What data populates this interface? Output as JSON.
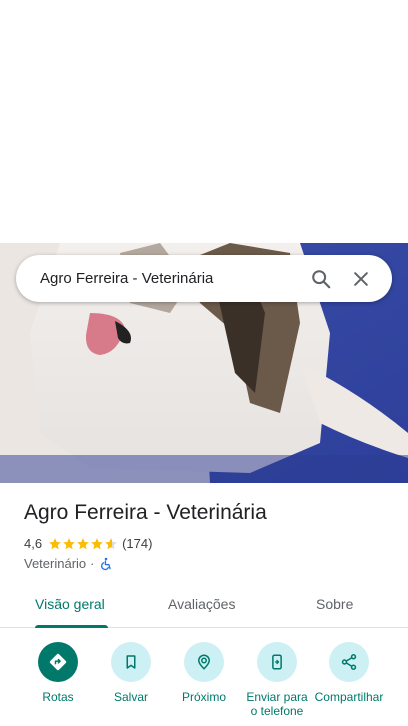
{
  "search": {
    "query": "Agro Ferreira - Veterinária"
  },
  "place": {
    "name": "Agro Ferreira - Veterinária",
    "rating": "4,6",
    "stars": 4.6,
    "review_count": "(174)",
    "category": "Veterinário",
    "separator": "·"
  },
  "tabs": [
    {
      "label": "Visão geral"
    },
    {
      "label": "Avaliações"
    },
    {
      "label": "Sobre"
    }
  ],
  "actions": [
    {
      "label": "Rotas",
      "icon": "directions-icon"
    },
    {
      "label": "Salvar",
      "icon": "bookmark-icon"
    },
    {
      "label": "Próximo",
      "icon": "nearby-icon"
    },
    {
      "label": "Enviar para o telefone",
      "icon": "send-to-phone-icon"
    },
    {
      "label": "Compartilhar",
      "icon": "share-icon"
    }
  ],
  "colors": {
    "accent": "#00796b",
    "star": "#fbbc04",
    "action_bg": "#cdf0f5",
    "accessibility": "#1a73e8"
  }
}
